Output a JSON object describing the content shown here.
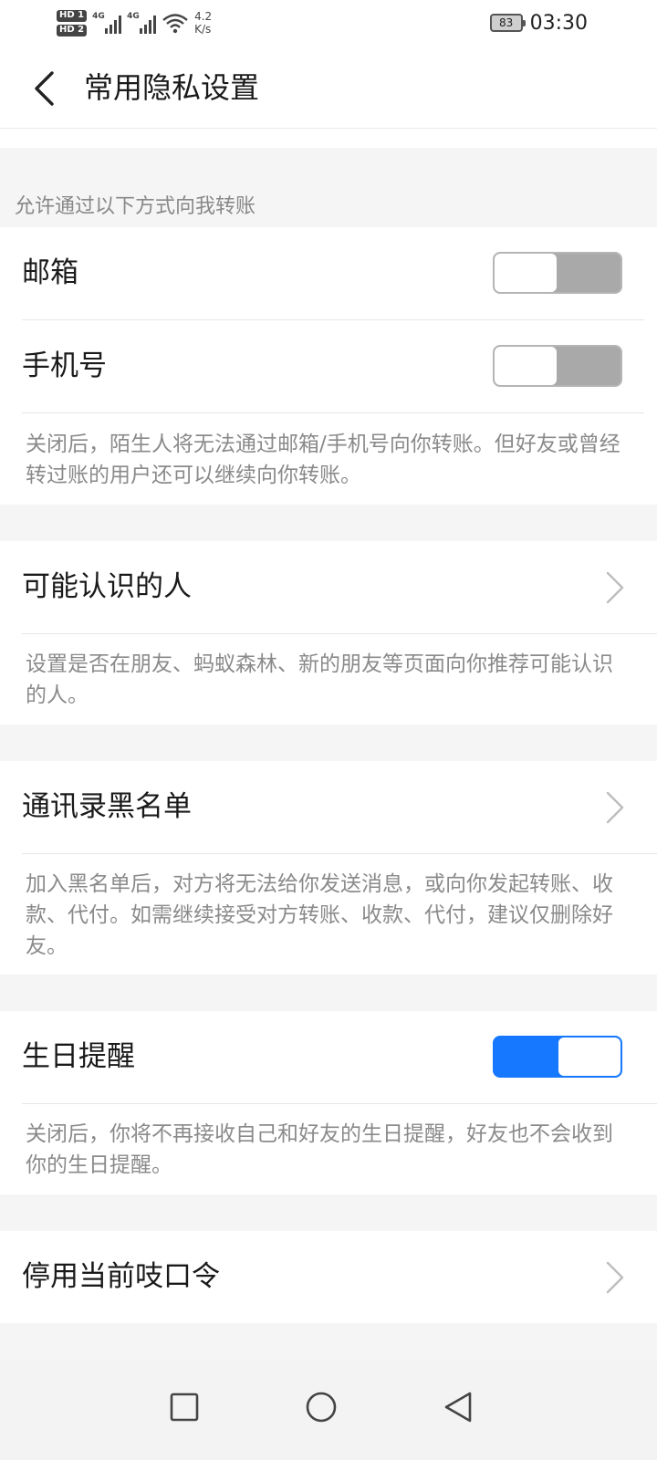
{
  "status_bar": {
    "hd1": "HD 1",
    "hd2": "HD 2",
    "net1": "4G",
    "net2": "4G",
    "speed_value": "4.2",
    "speed_unit": "K/s",
    "battery": "83",
    "time": "03:30"
  },
  "header": {
    "title": "常用隐私设置"
  },
  "transfer_section": {
    "header": "允许通过以下方式向我转账",
    "items": [
      {
        "label": "邮箱",
        "toggle": "off"
      },
      {
        "label": "手机号",
        "toggle": "off"
      }
    ],
    "description": "关闭后，陌生人将无法通过邮箱/手机号向你转账。但好友或曾经转过账的用户还可以继续向你转账。"
  },
  "people_section": {
    "label": "可能认识的人",
    "description": "设置是否在朋友、蚂蚁森林、新的朋友等页面向你推荐可能认识的人。"
  },
  "blacklist_section": {
    "label": "通讯录黑名单",
    "description": "加入黑名单后，对方将无法给你发送消息，或向你发起转账、收款、代付。如需继续接受对方转账、收款、代付，建议仅删除好友。"
  },
  "birthday_section": {
    "label": "生日提醒",
    "toggle": "on",
    "description": "关闭后，你将不再接收自己和好友的生日提醒，好友也不会收到你的生日提醒。"
  },
  "password_section": {
    "label": "停用当前吱口令"
  },
  "colors": {
    "accent": "#1677ff",
    "toggle_off": "#a9a9a9",
    "background": "#f5f5f5"
  },
  "icons": {
    "back": "chevron-left-icon",
    "chevron": "chevron-right-icon",
    "square": "recent-apps-icon",
    "circle": "home-icon",
    "triangle": "back-triangle-icon"
  }
}
